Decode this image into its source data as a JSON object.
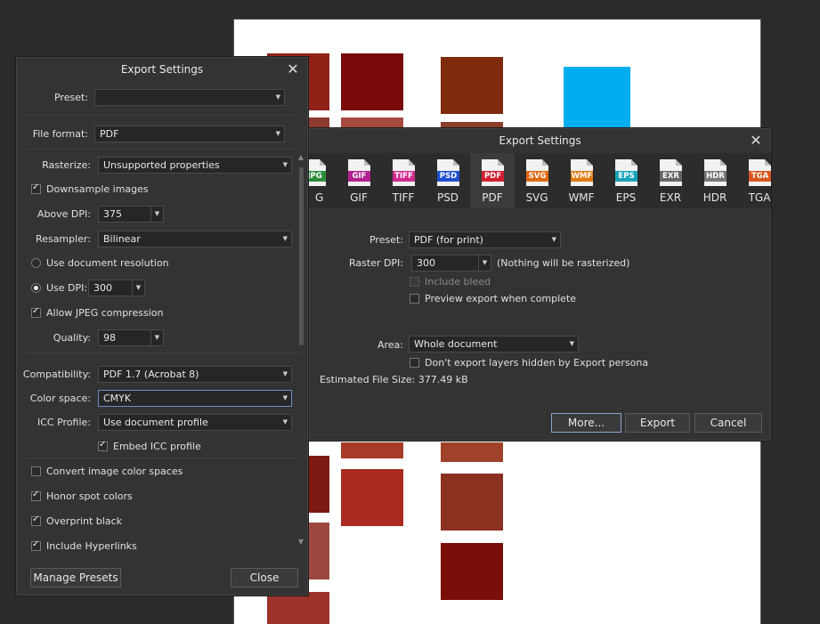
{
  "left_dialog": {
    "title": "Export Settings",
    "preset_label": "Preset:",
    "preset_value": "",
    "file_format_label": "File format:",
    "file_format_value": "PDF",
    "rasterize_label": "Rasterize:",
    "rasterize_value": "Unsupported properties",
    "downsample_label": "Downsample images",
    "above_dpi_label": "Above DPI:",
    "above_dpi_value": "375",
    "resampler_label": "Resampler:",
    "resampler_value": "Bilinear",
    "use_doc_res_label": "Use document resolution",
    "use_dpi_label": "Use DPI:",
    "use_dpi_value": "300",
    "allow_jpeg_label": "Allow JPEG compression",
    "quality_label": "Quality:",
    "quality_value": "98",
    "compatibility_label": "Compatibility:",
    "compatibility_value": "PDF 1.7 (Acrobat 8)",
    "color_space_label": "Color space:",
    "color_space_value": "CMYK",
    "icc_profile_label": "ICC Profile:",
    "icc_profile_value": "Use document profile",
    "embed_icc_label": "Embed ICC profile",
    "convert_color_label": "Convert image color spaces",
    "honor_spot_label": "Honor spot colors",
    "overprint_label": "Overprint black",
    "hyperlinks_label": "Include Hyperlinks",
    "manage_presets_label": "Manage Presets",
    "close_label": "Close"
  },
  "right_dialog": {
    "title": "Export Settings",
    "formats": [
      {
        "name": "JPEG",
        "tag": "JPG",
        "color": "#2e8b3c"
      },
      {
        "name": "GIF",
        "tag": "GIF",
        "color": "#b0208e"
      },
      {
        "name": "TIFF",
        "tag": "TIFF",
        "color": "#d02b8f"
      },
      {
        "name": "PSD",
        "tag": "PSD",
        "color": "#1f4fcf"
      },
      {
        "name": "PDF",
        "tag": "PDF",
        "color": "#d21f2f"
      },
      {
        "name": "SVG",
        "tag": "SVG",
        "color": "#e06a12"
      },
      {
        "name": "WMF",
        "tag": "WMF",
        "color": "#e07a12"
      },
      {
        "name": "EPS",
        "tag": "EPS",
        "color": "#1aa3b8"
      },
      {
        "name": "EXR",
        "tag": "EXR",
        "color": "#666666"
      },
      {
        "name": "HDR",
        "tag": "HDR",
        "color": "#777777"
      },
      {
        "name": "TGA",
        "tag": "TGA",
        "color": "#d8561e"
      }
    ],
    "first_format_visible_name": "G",
    "preset_label": "Preset:",
    "preset_value": "PDF (for print)",
    "raster_dpi_label": "Raster DPI:",
    "raster_dpi_value": "300",
    "raster_note": "(Nothing will be rasterized)",
    "include_bleed_label": "Include bleed",
    "preview_export_label": "Preview export when complete",
    "area_label": "Area:",
    "area_value": "Whole document",
    "dont_export_label": "Don't export layers hidden by Export persona",
    "file_size_label": "Estimated File Size: 377.49 kB",
    "more_label": "More...",
    "export_label": "Export",
    "cancel_label": "Cancel"
  }
}
